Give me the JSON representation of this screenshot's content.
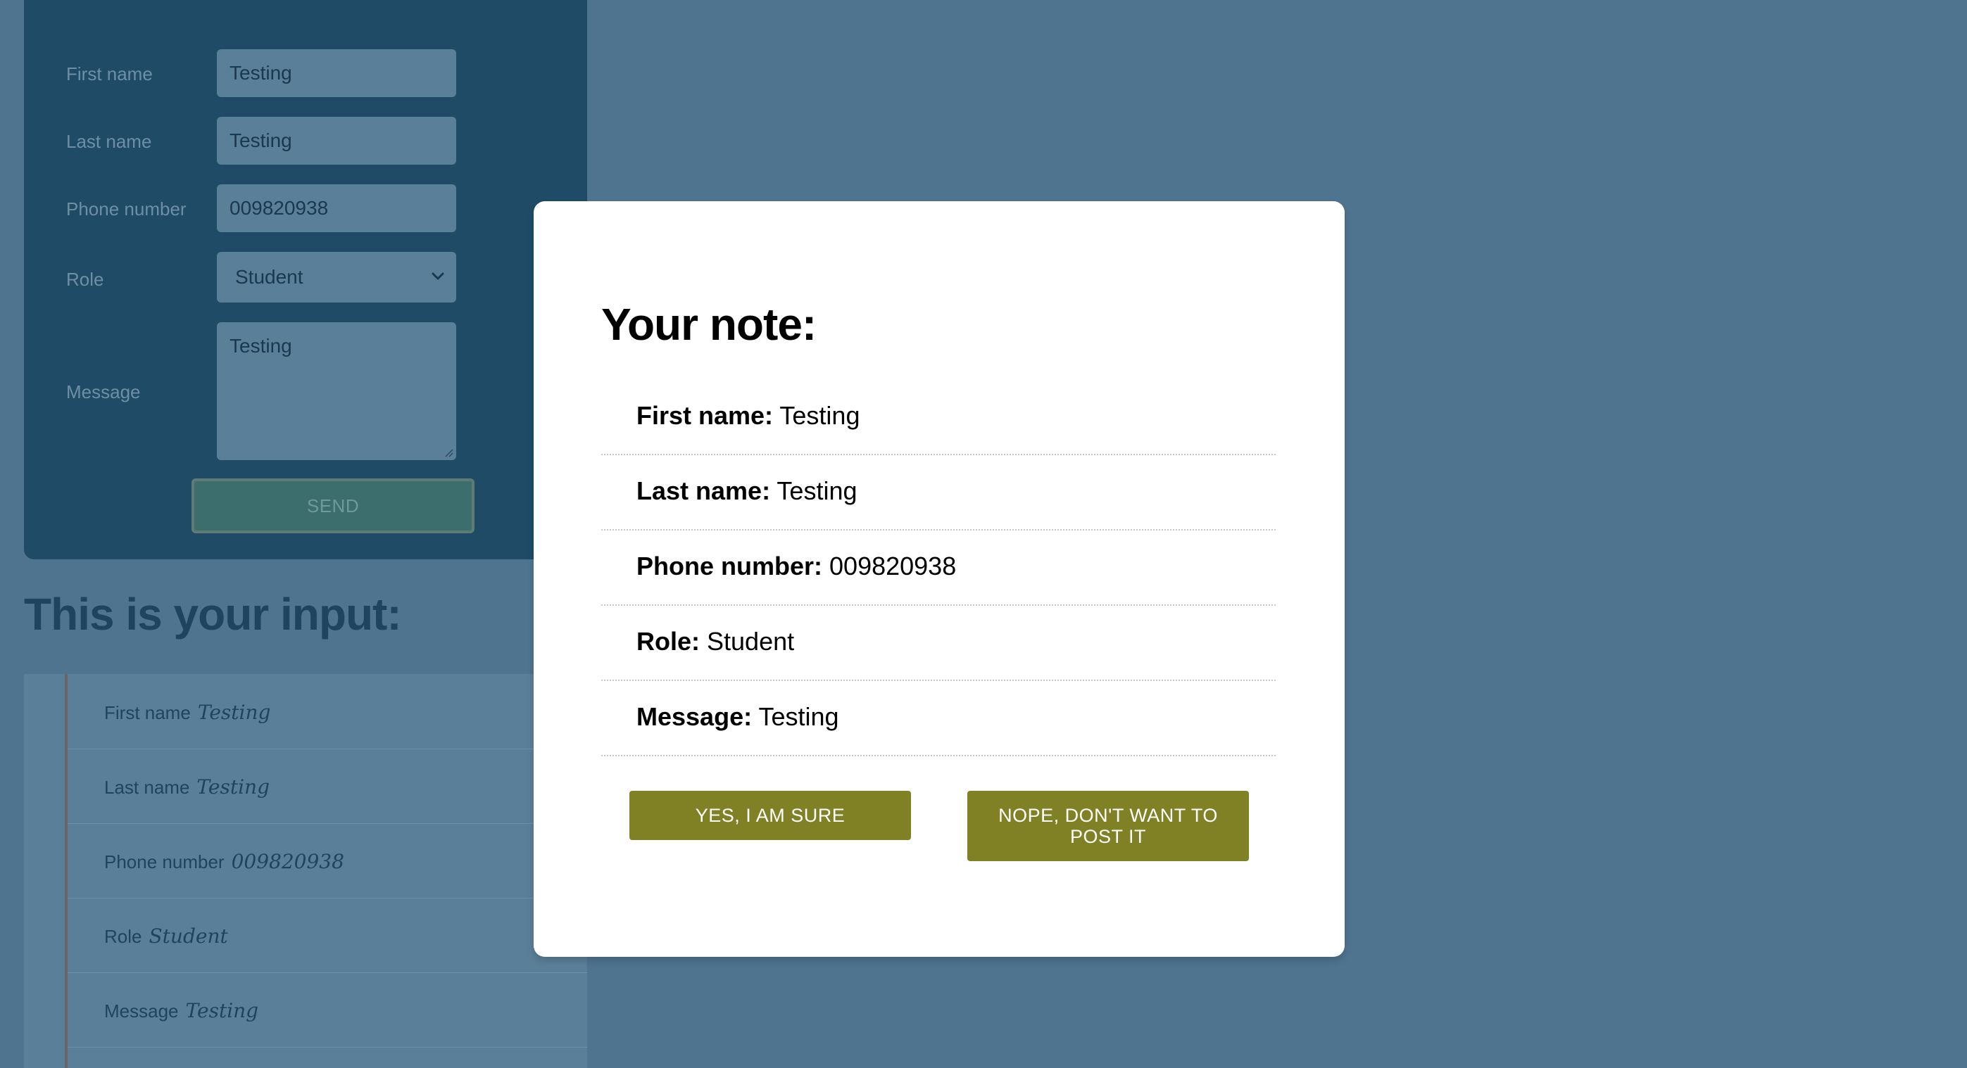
{
  "form": {
    "fields": [
      {
        "label": "First name",
        "value": "Testing"
      },
      {
        "label": "Last name",
        "value": "Testing"
      },
      {
        "label": "Phone number",
        "value": "009820938"
      },
      {
        "label": "Role",
        "value": "Student"
      },
      {
        "label": "Message",
        "value": "Testing"
      }
    ],
    "send_label": "SEND"
  },
  "input_section": {
    "heading": "This is your input:",
    "items": [
      {
        "label": "First name",
        "value": "Testing"
      },
      {
        "label": "Last name",
        "value": "Testing"
      },
      {
        "label": "Phone number",
        "value": "009820938"
      },
      {
        "label": "Role",
        "value": "Student"
      },
      {
        "label": "Message",
        "value": "Testing"
      }
    ]
  },
  "modal": {
    "title": "Your note:",
    "rows": [
      {
        "label": "First name:",
        "value": "Testing"
      },
      {
        "label": "Last name:",
        "value": "Testing"
      },
      {
        "label": "Phone number:",
        "value": "009820938"
      },
      {
        "label": "Role:",
        "value": "Student"
      },
      {
        "label": "Message:",
        "value": "Testing"
      }
    ],
    "confirm_label": "YES, I AM SURE",
    "cancel_label": "NOPE, DON'T WANT TO POST IT"
  },
  "colors": {
    "page_background": "#4f7490",
    "form_card": "#1f4b67",
    "modal_background": "#ffffff",
    "button_olive": "#808025"
  },
  "icons": {
    "select_arrow": "chevron-down-icon",
    "textarea_resize": "resize-grip-icon"
  }
}
